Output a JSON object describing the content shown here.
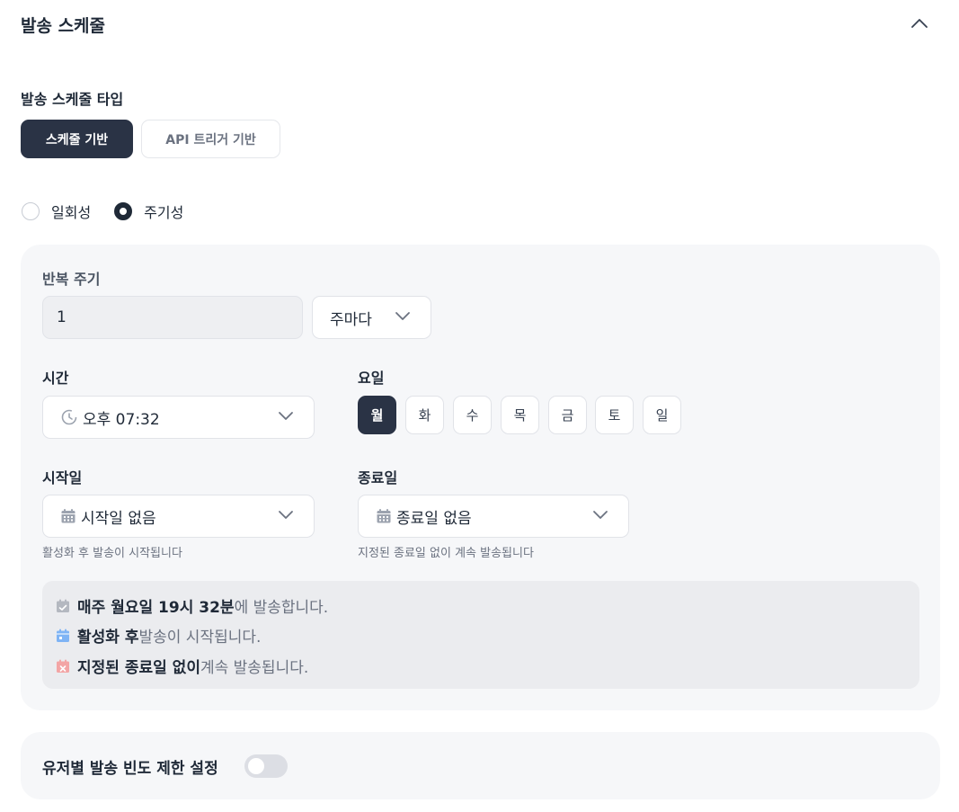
{
  "header": {
    "title": "발송 스케줄"
  },
  "schedule_type": {
    "label": "발송 스케줄 타입",
    "options": [
      "스케줄 기반",
      "API 트리거 기반"
    ],
    "selected": "스케줄 기반"
  },
  "frequency": {
    "options": [
      "일회성",
      "주기성"
    ],
    "selected": "주기성"
  },
  "repeat": {
    "label": "반복 주기",
    "value": "1",
    "unit": "주마다"
  },
  "time": {
    "label": "시간",
    "value": "오후 07:32",
    "icon": "clock-icon"
  },
  "weekday": {
    "label": "요일",
    "days": [
      "월",
      "화",
      "수",
      "목",
      "금",
      "토",
      "일"
    ],
    "selected": [
      "월"
    ]
  },
  "start_date": {
    "label": "시작일",
    "value": "시작일 없음",
    "helper": "활성화 후 발송이 시작됩니다",
    "icon": "calendar-icon"
  },
  "end_date": {
    "label": "종료일",
    "value": "종료일 없음",
    "helper": "지정된 종료일 없이 계속 발송됩니다",
    "icon": "calendar-icon"
  },
  "summary": {
    "line1": {
      "bold": "매주 월요일 19시 32분",
      "rest": "에 발송합니다.",
      "icon": "calendar-check-icon"
    },
    "line2": {
      "bold": "활성화 후",
      "rest": " 발송이 시작됩니다.",
      "icon": "calendar-start-icon"
    },
    "line3": {
      "bold": "지정된 종료일 없이",
      "rest": " 계속 발송됩니다.",
      "icon": "calendar-x-icon"
    }
  },
  "frequency_limit": {
    "label": "유저별 발송 빈도 제한 설정",
    "enabled": false
  },
  "colors": {
    "primary": "#2a3345",
    "panel": "#f6f7f9",
    "summary_bg": "#ebecef",
    "icon_gray": "#9ca3af",
    "icon_blue": "#7fb4f5",
    "icon_red": "#f3a5a5"
  }
}
